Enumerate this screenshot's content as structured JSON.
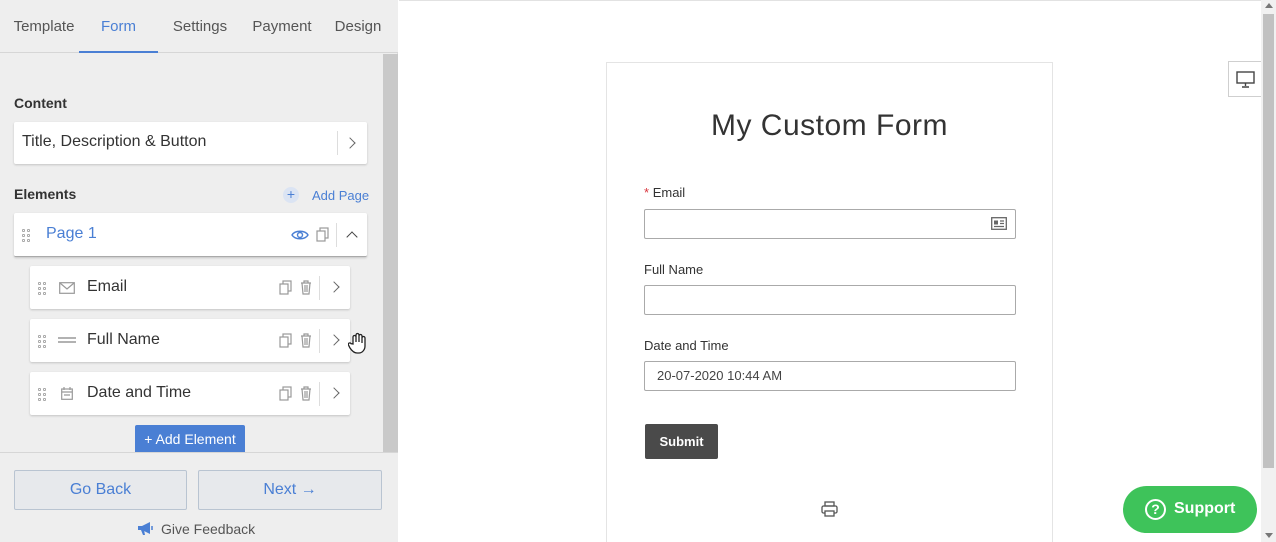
{
  "tabs": [
    "Template",
    "Form",
    "Settings",
    "Payment",
    "Design"
  ],
  "content_section": {
    "title": "Content",
    "item_label": "Title, Description & Button"
  },
  "elements_section": {
    "title": "Elements",
    "add_page_label": "Add Page",
    "page_label": "Page 1",
    "items": [
      "Email",
      "Full Name",
      "Date and Time"
    ],
    "add_element_label": "+ Add Element"
  },
  "footer": {
    "back_label": "Go Back",
    "next_label": "Next →",
    "feedback_label": "Give Feedback"
  },
  "preview": {
    "form_title": "My Custom Form",
    "required_mark": "*",
    "email_label": "Email",
    "fullname_label": "Full Name",
    "datetime_label": "Date and Time",
    "datetime_value": "20-07-2020 10:44 AM",
    "submit_label": "Submit"
  },
  "support_label": "Support",
  "colors": {
    "accent": "#4a7fd4",
    "support": "#3ec35a",
    "submit": "#4a4a4a",
    "required": "#d9363e"
  }
}
